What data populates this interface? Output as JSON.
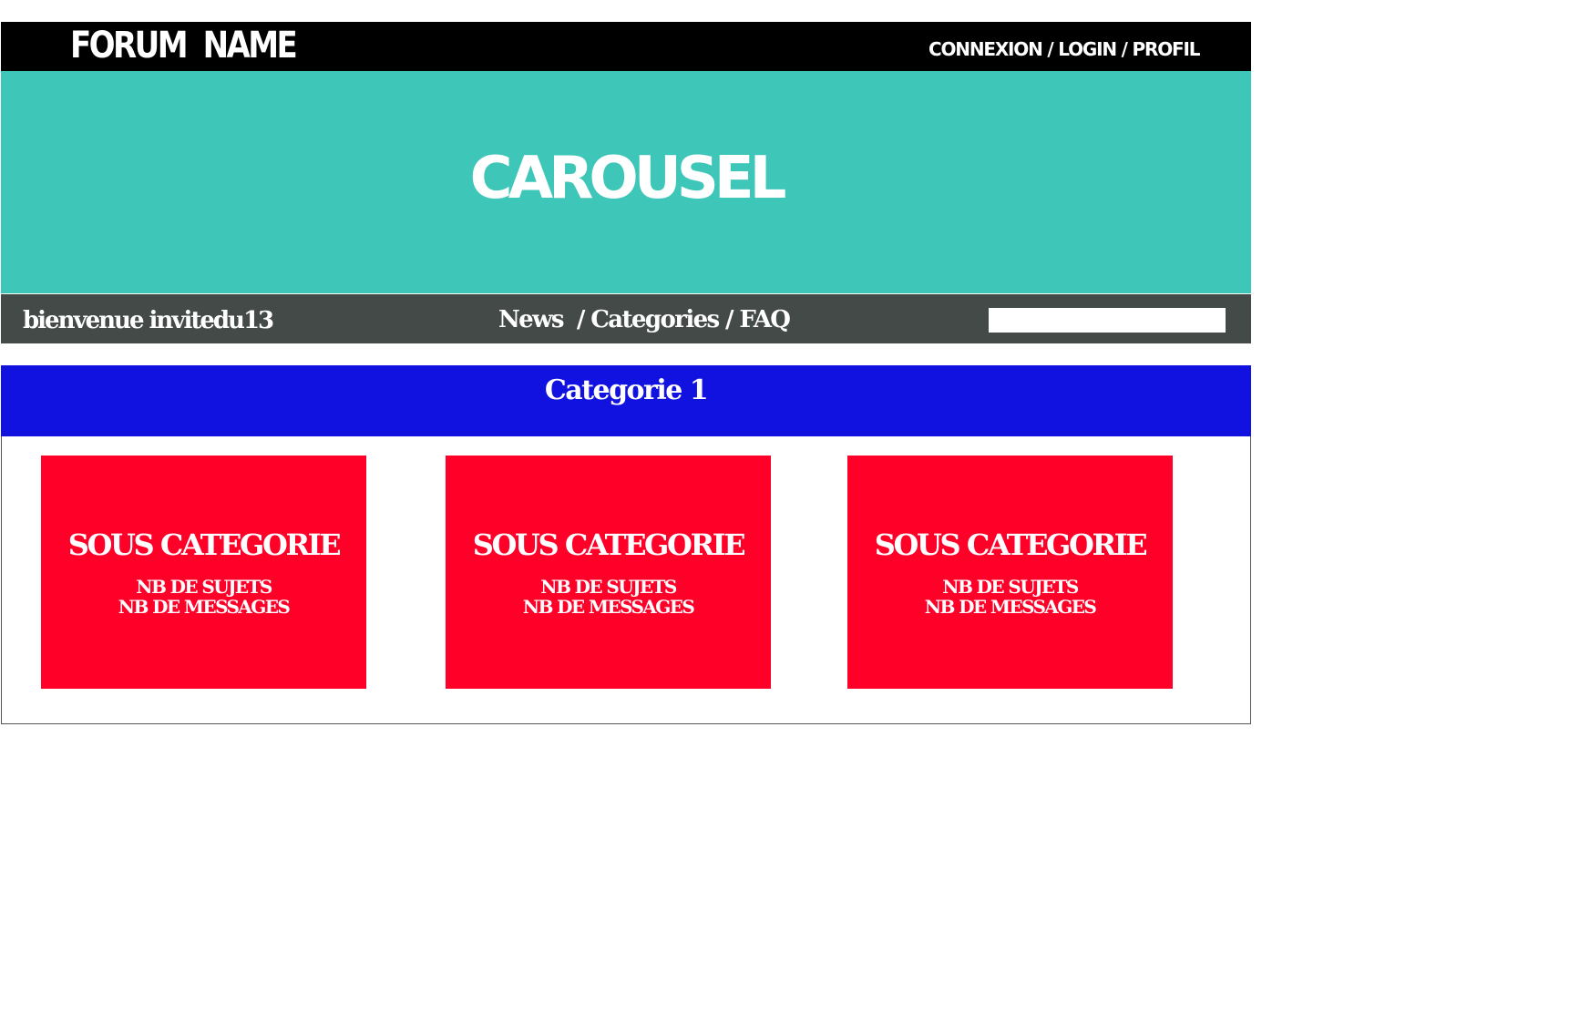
{
  "header": {
    "forum_name": "FORUM  NAME",
    "account_links": [
      {
        "label": "CONNEXION"
      },
      {
        "label": "LOGIN"
      },
      {
        "label": "PROFIL"
      }
    ],
    "separator": " / "
  },
  "carousel": {
    "label": "CAROUSEL"
  },
  "navbar": {
    "welcome": "bienvenue invitedu13",
    "links": [
      {
        "label": "News "
      },
      {
        "label": "Categories"
      },
      {
        "label": "FAQ"
      }
    ],
    "search": {
      "value": "",
      "placeholder": ""
    }
  },
  "category": {
    "title": "Categorie 1",
    "subcategories": [
      {
        "title": "SOUS CATEGORIE",
        "topics": "NB DE SUJETS",
        "messages": "NB DE MESSAGES"
      },
      {
        "title": "SOUS CATEGORIE",
        "topics": "NB DE SUJETS",
        "messages": "NB DE MESSAGES"
      },
      {
        "title": "SOUS CATEGORIE",
        "topics": "NB DE SUJETS",
        "messages": "NB DE MESSAGES"
      }
    ]
  },
  "colors": {
    "topbar": "#000000",
    "carousel": "#3ec6b8",
    "navbar": "#434a47",
    "category_header": "#1212e0",
    "subcategory_card": "#ff0029",
    "text": "#ffffff"
  }
}
